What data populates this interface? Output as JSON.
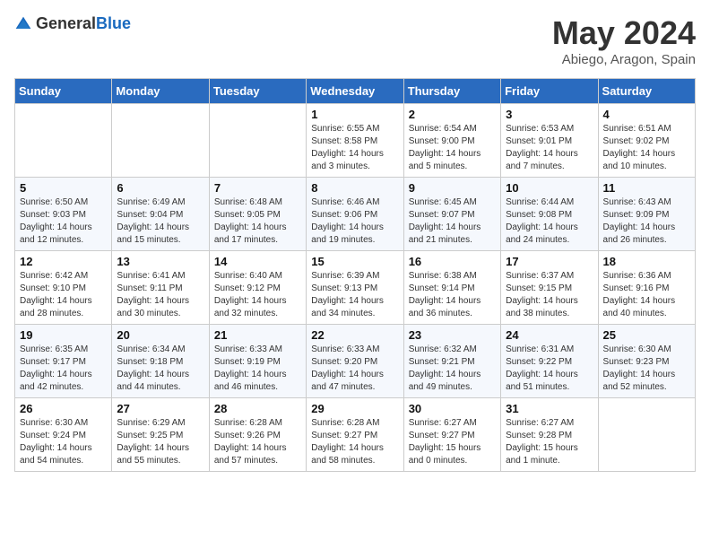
{
  "header": {
    "logo_general": "General",
    "logo_blue": "Blue",
    "month": "May 2024",
    "location": "Abiego, Aragon, Spain"
  },
  "weekdays": [
    "Sunday",
    "Monday",
    "Tuesday",
    "Wednesday",
    "Thursday",
    "Friday",
    "Saturday"
  ],
  "weeks": [
    [
      {
        "day": "",
        "sunrise": "",
        "sunset": "",
        "daylight": ""
      },
      {
        "day": "",
        "sunrise": "",
        "sunset": "",
        "daylight": ""
      },
      {
        "day": "",
        "sunrise": "",
        "sunset": "",
        "daylight": ""
      },
      {
        "day": "1",
        "sunrise": "Sunrise: 6:55 AM",
        "sunset": "Sunset: 8:58 PM",
        "daylight": "Daylight: 14 hours and 3 minutes."
      },
      {
        "day": "2",
        "sunrise": "Sunrise: 6:54 AM",
        "sunset": "Sunset: 9:00 PM",
        "daylight": "Daylight: 14 hours and 5 minutes."
      },
      {
        "day": "3",
        "sunrise": "Sunrise: 6:53 AM",
        "sunset": "Sunset: 9:01 PM",
        "daylight": "Daylight: 14 hours and 7 minutes."
      },
      {
        "day": "4",
        "sunrise": "Sunrise: 6:51 AM",
        "sunset": "Sunset: 9:02 PM",
        "daylight": "Daylight: 14 hours and 10 minutes."
      }
    ],
    [
      {
        "day": "5",
        "sunrise": "Sunrise: 6:50 AM",
        "sunset": "Sunset: 9:03 PM",
        "daylight": "Daylight: 14 hours and 12 minutes."
      },
      {
        "day": "6",
        "sunrise": "Sunrise: 6:49 AM",
        "sunset": "Sunset: 9:04 PM",
        "daylight": "Daylight: 14 hours and 15 minutes."
      },
      {
        "day": "7",
        "sunrise": "Sunrise: 6:48 AM",
        "sunset": "Sunset: 9:05 PM",
        "daylight": "Daylight: 14 hours and 17 minutes."
      },
      {
        "day": "8",
        "sunrise": "Sunrise: 6:46 AM",
        "sunset": "Sunset: 9:06 PM",
        "daylight": "Daylight: 14 hours and 19 minutes."
      },
      {
        "day": "9",
        "sunrise": "Sunrise: 6:45 AM",
        "sunset": "Sunset: 9:07 PM",
        "daylight": "Daylight: 14 hours and 21 minutes."
      },
      {
        "day": "10",
        "sunrise": "Sunrise: 6:44 AM",
        "sunset": "Sunset: 9:08 PM",
        "daylight": "Daylight: 14 hours and 24 minutes."
      },
      {
        "day": "11",
        "sunrise": "Sunrise: 6:43 AM",
        "sunset": "Sunset: 9:09 PM",
        "daylight": "Daylight: 14 hours and 26 minutes."
      }
    ],
    [
      {
        "day": "12",
        "sunrise": "Sunrise: 6:42 AM",
        "sunset": "Sunset: 9:10 PM",
        "daylight": "Daylight: 14 hours and 28 minutes."
      },
      {
        "day": "13",
        "sunrise": "Sunrise: 6:41 AM",
        "sunset": "Sunset: 9:11 PM",
        "daylight": "Daylight: 14 hours and 30 minutes."
      },
      {
        "day": "14",
        "sunrise": "Sunrise: 6:40 AM",
        "sunset": "Sunset: 9:12 PM",
        "daylight": "Daylight: 14 hours and 32 minutes."
      },
      {
        "day": "15",
        "sunrise": "Sunrise: 6:39 AM",
        "sunset": "Sunset: 9:13 PM",
        "daylight": "Daylight: 14 hours and 34 minutes."
      },
      {
        "day": "16",
        "sunrise": "Sunrise: 6:38 AM",
        "sunset": "Sunset: 9:14 PM",
        "daylight": "Daylight: 14 hours and 36 minutes."
      },
      {
        "day": "17",
        "sunrise": "Sunrise: 6:37 AM",
        "sunset": "Sunset: 9:15 PM",
        "daylight": "Daylight: 14 hours and 38 minutes."
      },
      {
        "day": "18",
        "sunrise": "Sunrise: 6:36 AM",
        "sunset": "Sunset: 9:16 PM",
        "daylight": "Daylight: 14 hours and 40 minutes."
      }
    ],
    [
      {
        "day": "19",
        "sunrise": "Sunrise: 6:35 AM",
        "sunset": "Sunset: 9:17 PM",
        "daylight": "Daylight: 14 hours and 42 minutes."
      },
      {
        "day": "20",
        "sunrise": "Sunrise: 6:34 AM",
        "sunset": "Sunset: 9:18 PM",
        "daylight": "Daylight: 14 hours and 44 minutes."
      },
      {
        "day": "21",
        "sunrise": "Sunrise: 6:33 AM",
        "sunset": "Sunset: 9:19 PM",
        "daylight": "Daylight: 14 hours and 46 minutes."
      },
      {
        "day": "22",
        "sunrise": "Sunrise: 6:33 AM",
        "sunset": "Sunset: 9:20 PM",
        "daylight": "Daylight: 14 hours and 47 minutes."
      },
      {
        "day": "23",
        "sunrise": "Sunrise: 6:32 AM",
        "sunset": "Sunset: 9:21 PM",
        "daylight": "Daylight: 14 hours and 49 minutes."
      },
      {
        "day": "24",
        "sunrise": "Sunrise: 6:31 AM",
        "sunset": "Sunset: 9:22 PM",
        "daylight": "Daylight: 14 hours and 51 minutes."
      },
      {
        "day": "25",
        "sunrise": "Sunrise: 6:30 AM",
        "sunset": "Sunset: 9:23 PM",
        "daylight": "Daylight: 14 hours and 52 minutes."
      }
    ],
    [
      {
        "day": "26",
        "sunrise": "Sunrise: 6:30 AM",
        "sunset": "Sunset: 9:24 PM",
        "daylight": "Daylight: 14 hours and 54 minutes."
      },
      {
        "day": "27",
        "sunrise": "Sunrise: 6:29 AM",
        "sunset": "Sunset: 9:25 PM",
        "daylight": "Daylight: 14 hours and 55 minutes."
      },
      {
        "day": "28",
        "sunrise": "Sunrise: 6:28 AM",
        "sunset": "Sunset: 9:26 PM",
        "daylight": "Daylight: 14 hours and 57 minutes."
      },
      {
        "day": "29",
        "sunrise": "Sunrise: 6:28 AM",
        "sunset": "Sunset: 9:27 PM",
        "daylight": "Daylight: 14 hours and 58 minutes."
      },
      {
        "day": "30",
        "sunrise": "Sunrise: 6:27 AM",
        "sunset": "Sunset: 9:27 PM",
        "daylight": "Daylight: 15 hours and 0 minutes."
      },
      {
        "day": "31",
        "sunrise": "Sunrise: 6:27 AM",
        "sunset": "Sunset: 9:28 PM",
        "daylight": "Daylight: 15 hours and 1 minute."
      },
      {
        "day": "",
        "sunrise": "",
        "sunset": "",
        "daylight": ""
      }
    ]
  ]
}
